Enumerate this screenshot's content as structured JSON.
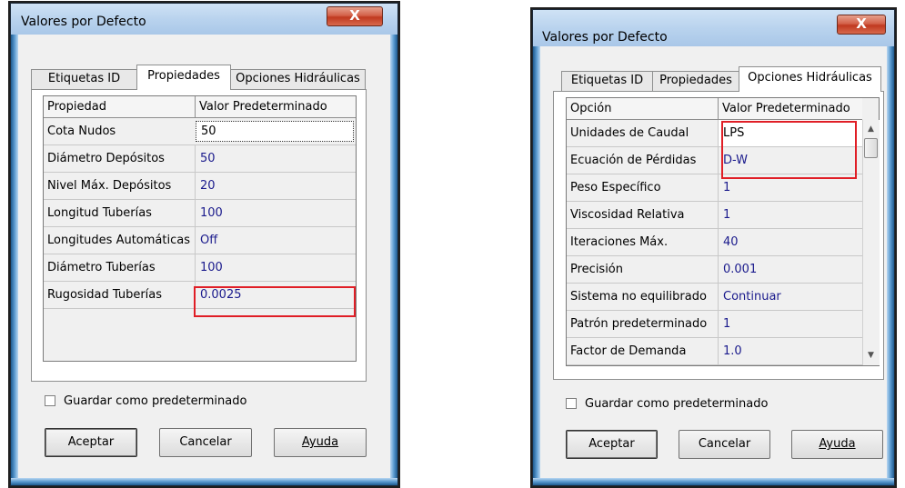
{
  "left_dialog": {
    "title": "Valores por Defecto",
    "close_label": "X",
    "tabs": [
      {
        "label": "Etiquetas ID",
        "active": false
      },
      {
        "label": "Propiedades",
        "active": true
      },
      {
        "label": "Opciones Hidráulicas",
        "active": false
      }
    ],
    "columns": [
      "Propiedad",
      "Valor Predeterminado"
    ],
    "rows": [
      {
        "name": "Cota Nudos",
        "value": "50"
      },
      {
        "name": "Diámetro Depósitos",
        "value": "50"
      },
      {
        "name": "Nivel Máx. Depósitos",
        "value": "20"
      },
      {
        "name": "Longitud Tuberías",
        "value": "100"
      },
      {
        "name": "Longitudes Automáticas",
        "value": "Off"
      },
      {
        "name": "Diámetro Tuberías",
        "value": "100"
      },
      {
        "name": "Rugosidad Tuberías",
        "value": "0.0025"
      }
    ],
    "checkbox_label": "Guardar como predeterminado",
    "buttons": {
      "ok": "Aceptar",
      "cancel": "Cancelar",
      "help": "Ayuda"
    }
  },
  "right_dialog": {
    "title": "Valores por Defecto",
    "close_label": "X",
    "tabs": [
      {
        "label": "Etiquetas ID",
        "active": false
      },
      {
        "label": "Propiedades",
        "active": false
      },
      {
        "label": "Opciones Hidráulicas",
        "active": true
      }
    ],
    "columns": [
      "Opción",
      "Valor Predeterminado"
    ],
    "rows": [
      {
        "name": "Unidades de Caudal",
        "value": "LPS"
      },
      {
        "name": "Ecuación de Pérdidas",
        "value": "D-W"
      },
      {
        "name": "Peso Específico",
        "value": "1"
      },
      {
        "name": "Viscosidad Relativa",
        "value": "1"
      },
      {
        "name": "Iteraciones Máx.",
        "value": "40"
      },
      {
        "name": "Precisión",
        "value": "0.001"
      },
      {
        "name": "Sistema no equilibrado",
        "value": "Continuar"
      },
      {
        "name": "Patrón predeterminado",
        "value": "1"
      },
      {
        "name": "Factor de Demanda",
        "value": "1.0"
      }
    ],
    "checkbox_label": "Guardar como predeterminado",
    "buttons": {
      "ok": "Aceptar",
      "cancel": "Cancelar",
      "help": "Ayuda"
    }
  },
  "colors": {
    "highlight_box": "#e01e26",
    "value_text": "#1a1a8c",
    "title_bar": "#b9d3ee"
  }
}
